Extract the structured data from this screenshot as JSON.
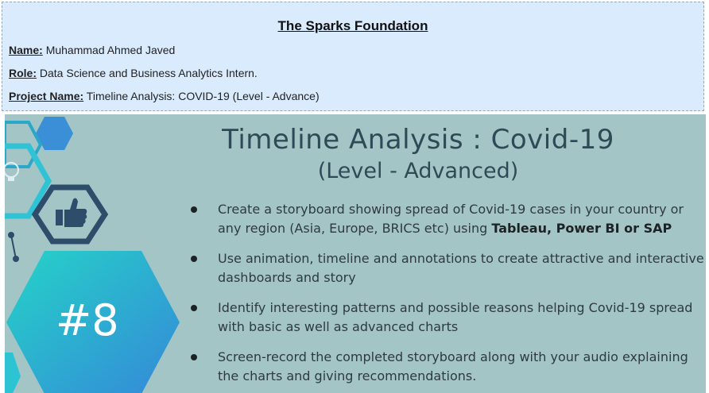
{
  "header": {
    "title": "The Sparks Foundation",
    "name_label": "Name:",
    "name_value": "Muhammad Ahmed Javed",
    "role_label": "Role:",
    "role_value": "Data Science and Business Analytics Intern.",
    "project_label": "Project Name:",
    "project_value": "Timeline Analysis: COVID-19 (Level - Advance)"
  },
  "poster": {
    "title": "Timeline Analysis : Covid-19",
    "subtitle": "(Level - Advanced)",
    "number": "#8",
    "bullets": [
      {
        "text": "Create a storyboard showing spread of Covid-19 cases in your country or any region (Asia, Europe, BRICS etc) using ",
        "bold": "Tableau, Power BI or SAP"
      },
      {
        "text": " Use animation, timeline and annotations to create attractive and interactive dashboards and story",
        "bold": ""
      },
      {
        "text": "Identify interesting patterns and possible reasons helping Covid-19 spread with basic as well as advanced charts",
        "bold": ""
      },
      {
        "text": "Screen-record the completed storyboard along with your audio explaining the charts and giving recommendations.",
        "bold": ""
      }
    ],
    "icons": [
      "thumbs-up-icon",
      "lightbulb-icon"
    ],
    "colors": {
      "background": "#a4c5c6",
      "accent_teal": "#26c6cf",
      "accent_blue": "#3a8fd6",
      "dark_navy": "#2d4d6b"
    }
  }
}
